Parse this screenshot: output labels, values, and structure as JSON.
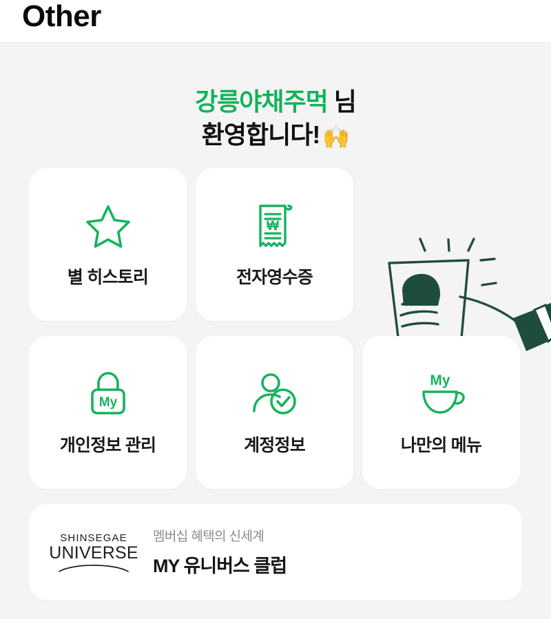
{
  "header": {
    "title": "Other"
  },
  "greeting": {
    "name": "강릉야채주먹",
    "honorific": " 님",
    "message": "환영합니다!",
    "emoji": "🙌",
    "name_color": "#11b25a"
  },
  "theme": {
    "brand_green": "#11b25a",
    "icon_green": "#17b25c",
    "illustration_green": "#1f4d3d",
    "page_background": "#f4f4f4",
    "card_background": "#ffffff",
    "text_primary": "#1a1a1a",
    "text_muted": "#8c8c8c"
  },
  "illustration": {
    "name": "hand-holding-coffee-cup-illustration"
  },
  "tiles": [
    {
      "id": "star-history",
      "label": "별 히스토리",
      "icon": "star-icon"
    },
    {
      "id": "e-receipt",
      "label": "전자영수증",
      "icon": "receipt-won-icon"
    },
    {
      "id": "privacy-manage",
      "label": "개인정보 관리",
      "icon": "lock-my-icon"
    },
    {
      "id": "account-info",
      "label": "계정정보",
      "icon": "person-check-icon"
    },
    {
      "id": "my-menu",
      "label": "나만의 메뉴",
      "icon": "my-coffee-cup-icon"
    }
  ],
  "banner": {
    "logo_top": "SHINSEGAE",
    "logo_bottom": "UNIVERSE",
    "subtitle": "멤버십 혜택의 신세계",
    "title": "MY 유니버스 클럽"
  }
}
